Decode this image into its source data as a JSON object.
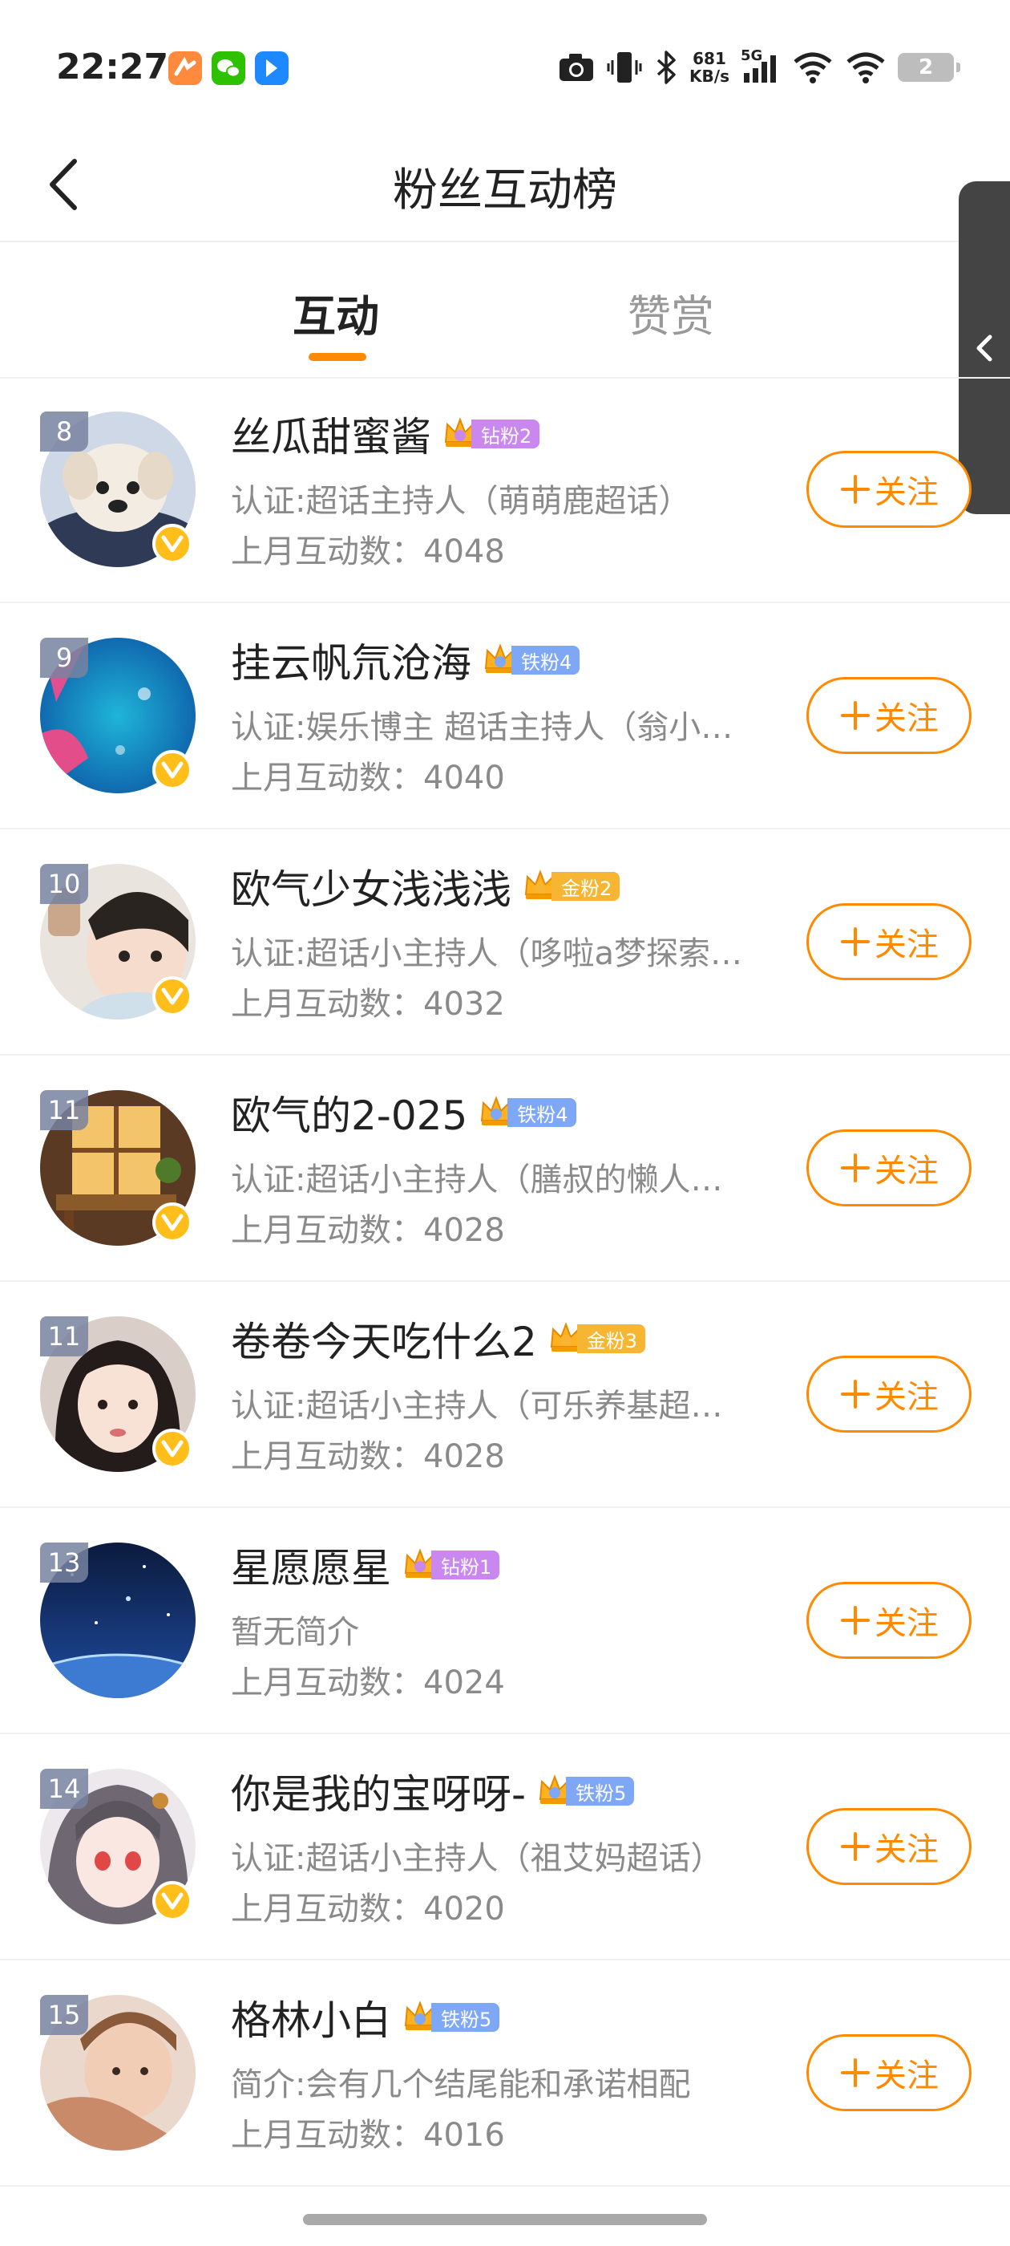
{
  "status_bar": {
    "time": "22:27",
    "net_speed_value": "681",
    "net_speed_unit": "KB/s",
    "signal_label": "5G",
    "battery_level": "2",
    "app_icons": [
      {
        "name": "orange-app-icon",
        "color": "#ff8a3d"
      },
      {
        "name": "wechat-icon",
        "color": "#2dc100"
      },
      {
        "name": "blue-app-icon",
        "color": "#1e88ff"
      }
    ]
  },
  "header": {
    "title": "粉丝互动榜"
  },
  "tabs": [
    {
      "label": "互动",
      "active": true
    },
    {
      "label": "赞赏",
      "active": false
    }
  ],
  "colors": {
    "accent": "#ff8a00",
    "verify": "#ffbe1a",
    "tag_diamond": "#c987ef",
    "tag_iron": "#7ea7f5",
    "tag_gold": "#f6b533"
  },
  "follow_label": "关注",
  "interact_prefix": "上月互动数：",
  "fans": [
    {
      "rank": "8",
      "name": "丝瓜甜蜜酱",
      "tag": "钻粉2",
      "tag_type": "diamond",
      "desc": "认证:超话主持人（萌萌鹿超话）",
      "count": "4048",
      "verified": true
    },
    {
      "rank": "9",
      "name": "挂云帆氘沧海",
      "tag": "铁粉4",
      "tag_type": "iron",
      "desc": "认证:娱乐博主 超话主持人（翁小…",
      "count": "4040",
      "verified": true
    },
    {
      "rank": "10",
      "name": "欧气少女浅浅浅",
      "tag": "金粉2",
      "tag_type": "gold",
      "desc": "认证:超话小主持人（哆啦a梦探索…",
      "count": "4032",
      "verified": true
    },
    {
      "rank": "11",
      "name": "欧气的2-025",
      "tag": "铁粉4",
      "tag_type": "iron",
      "desc": "认证:超话小主持人（膳叔的懒人…",
      "count": "4028",
      "verified": true
    },
    {
      "rank": "11",
      "name": "卷卷今天吃什么2",
      "tag": "金粉3",
      "tag_type": "gold",
      "desc": "认证:超话小主持人（可乐养基超…",
      "count": "4028",
      "verified": true
    },
    {
      "rank": "13",
      "name": "星愿愿星",
      "tag": "钻粉1",
      "tag_type": "diamond",
      "desc": "暂无简介",
      "count": "4024",
      "verified": false
    },
    {
      "rank": "14",
      "name": "你是我的宝呀呀-",
      "tag": "铁粉5",
      "tag_type": "iron",
      "desc": "认证:超话小主持人（祖艾妈超话）",
      "count": "4020",
      "verified": true
    },
    {
      "rank": "15",
      "name": "格林小白",
      "tag": "铁粉5",
      "tag_type": "iron",
      "desc": "简介:会有几个结尾能和承诺相配",
      "count": "4016",
      "verified": false
    }
  ]
}
